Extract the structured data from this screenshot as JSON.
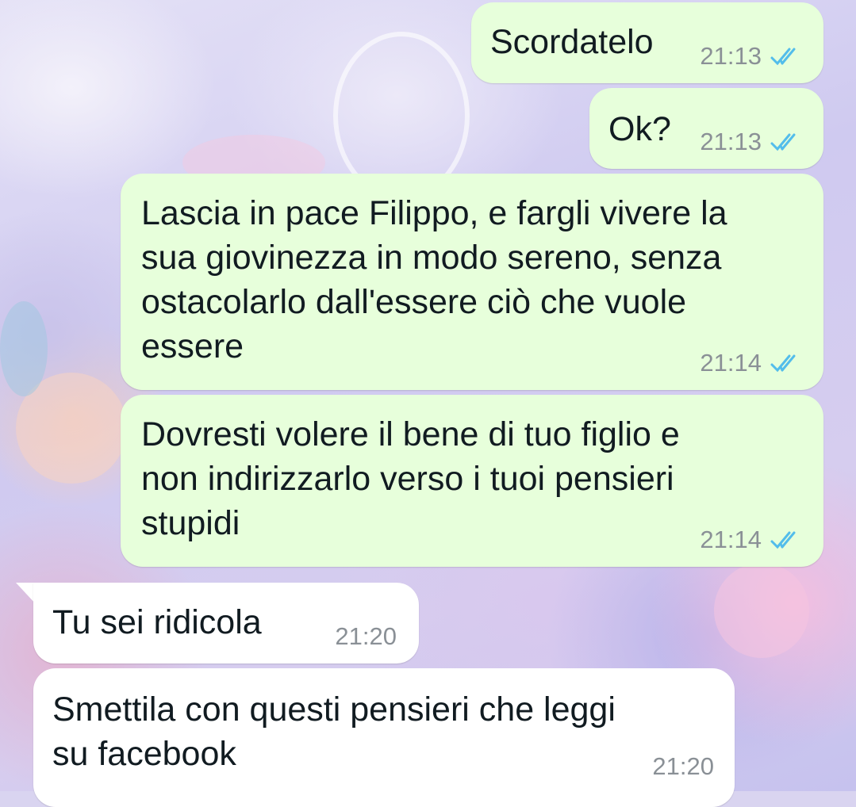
{
  "chat": {
    "messages": [
      {
        "direction": "outgoing",
        "text": "Scordatelo",
        "time": "21:13",
        "status": "read-double-check"
      },
      {
        "direction": "outgoing",
        "text": "Ok?",
        "time": "21:13",
        "status": "read-double-check"
      },
      {
        "direction": "outgoing",
        "text": "Lascia in pace Filippo, e fargli vivere la\nsua giovinezza in modo sereno, senza\nostacolarlo dall'essere ciò che vuole\nessere",
        "time": "21:14",
        "status": "read-double-check"
      },
      {
        "direction": "outgoing",
        "text": "Dovresti volere il bene di tuo figlio e\nnon indirizzarlo verso i tuoi pensieri\nstupidi",
        "time": "21:14",
        "status": "read-double-check"
      },
      {
        "direction": "incoming",
        "text": "Tu sei ridicola",
        "time": "21:20"
      },
      {
        "direction": "incoming",
        "text": "Smettila con questi pensieri che leggi\nsu facebook",
        "time": "21:20"
      }
    ]
  },
  "colors": {
    "outgoing_bubble": "#e7ffdb",
    "incoming_bubble": "#ffffff",
    "read_tick": "#53bdeb",
    "time_text": "#8a9096"
  }
}
